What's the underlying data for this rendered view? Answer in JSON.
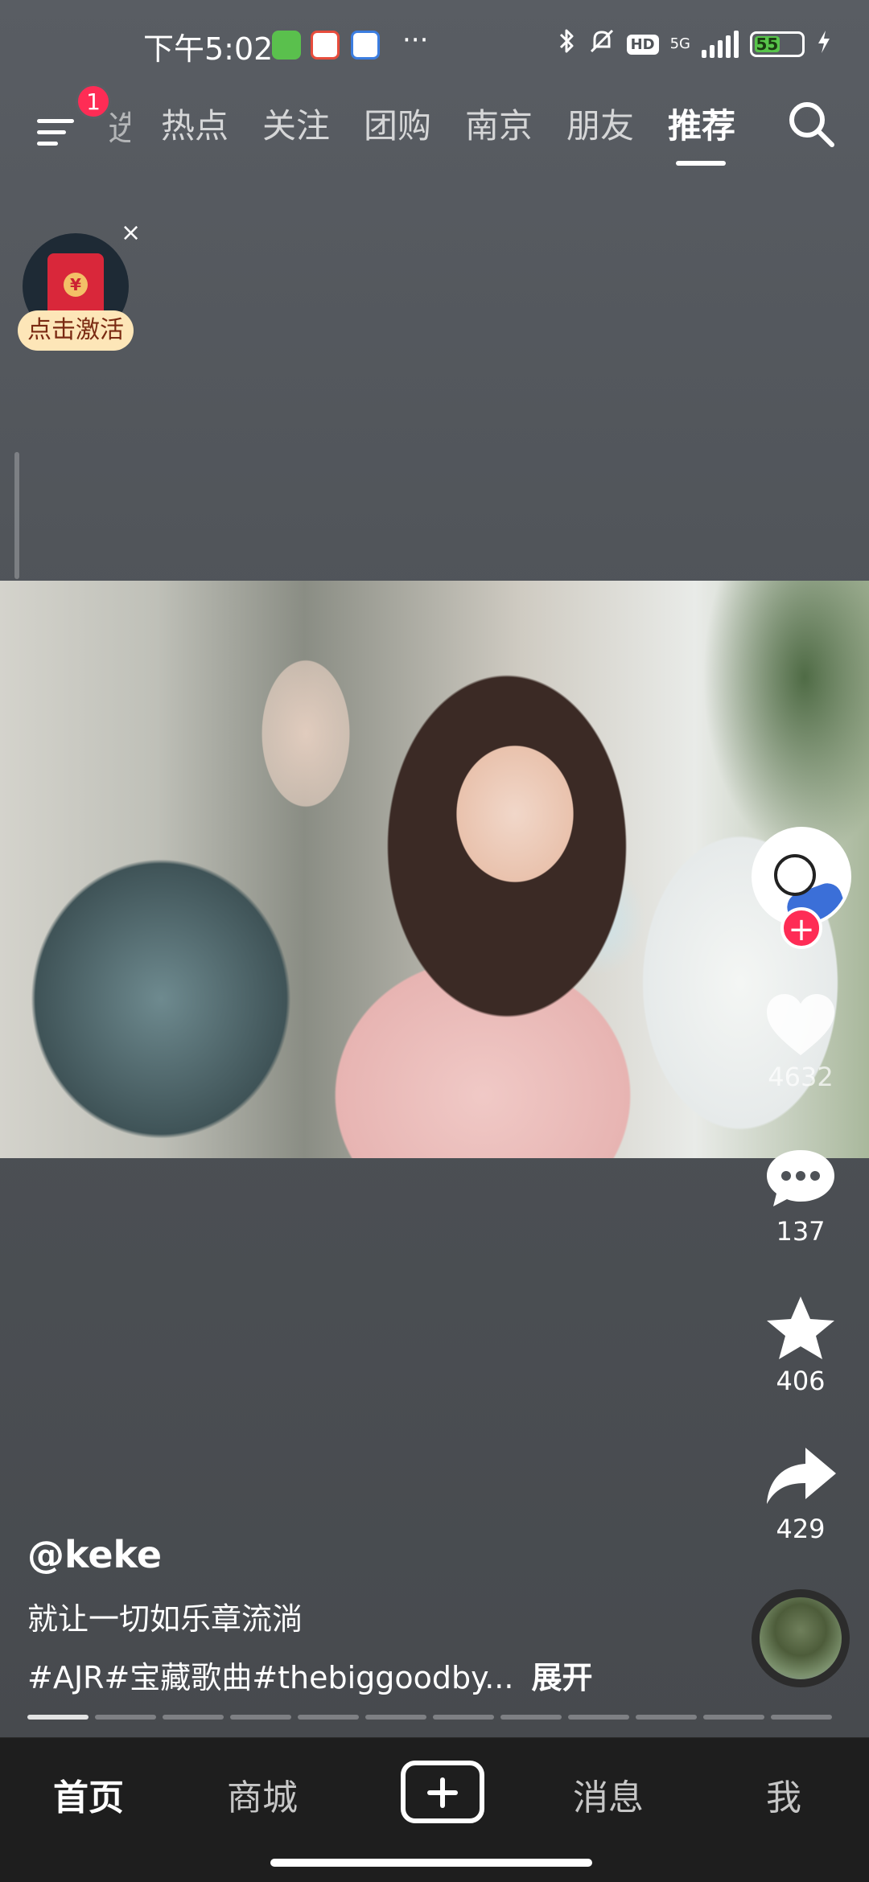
{
  "status_bar": {
    "time": "下午5:02",
    "more_dots": "···",
    "network": "5G",
    "battery": "55",
    "battery_level": 0.55
  },
  "top_nav": {
    "menu_badge": "1",
    "partial_tab": "选",
    "tabs": [
      "热点",
      "关注",
      "团购",
      "南京",
      "朋友",
      "推荐"
    ],
    "active_tab": "推荐"
  },
  "red_packet": {
    "label": "点击激活",
    "close": "×"
  },
  "right_rail": {
    "likes": "4632",
    "comments": "137",
    "favorites": "406",
    "shares": "429",
    "follow_symbol": "+"
  },
  "caption": {
    "author": "@keke",
    "description": "就让一切如乐章流淌",
    "tags": "#AJR#宝藏歌曲#thebiggoodby...",
    "expand": "展开"
  },
  "bottom_bar": {
    "home": "首页",
    "mall": "商城",
    "messages": "消息",
    "me": "我"
  },
  "colors": {
    "accent": "#fe2c55",
    "background": "#4e5257",
    "bottom_bar": "#1e1e1e"
  },
  "icons": [
    "menu-icon",
    "search-icon",
    "heart-icon",
    "comment-icon",
    "star-icon",
    "share-icon",
    "plus-icon",
    "bluetooth-icon",
    "mute-bell-icon",
    "charging-icon"
  ]
}
